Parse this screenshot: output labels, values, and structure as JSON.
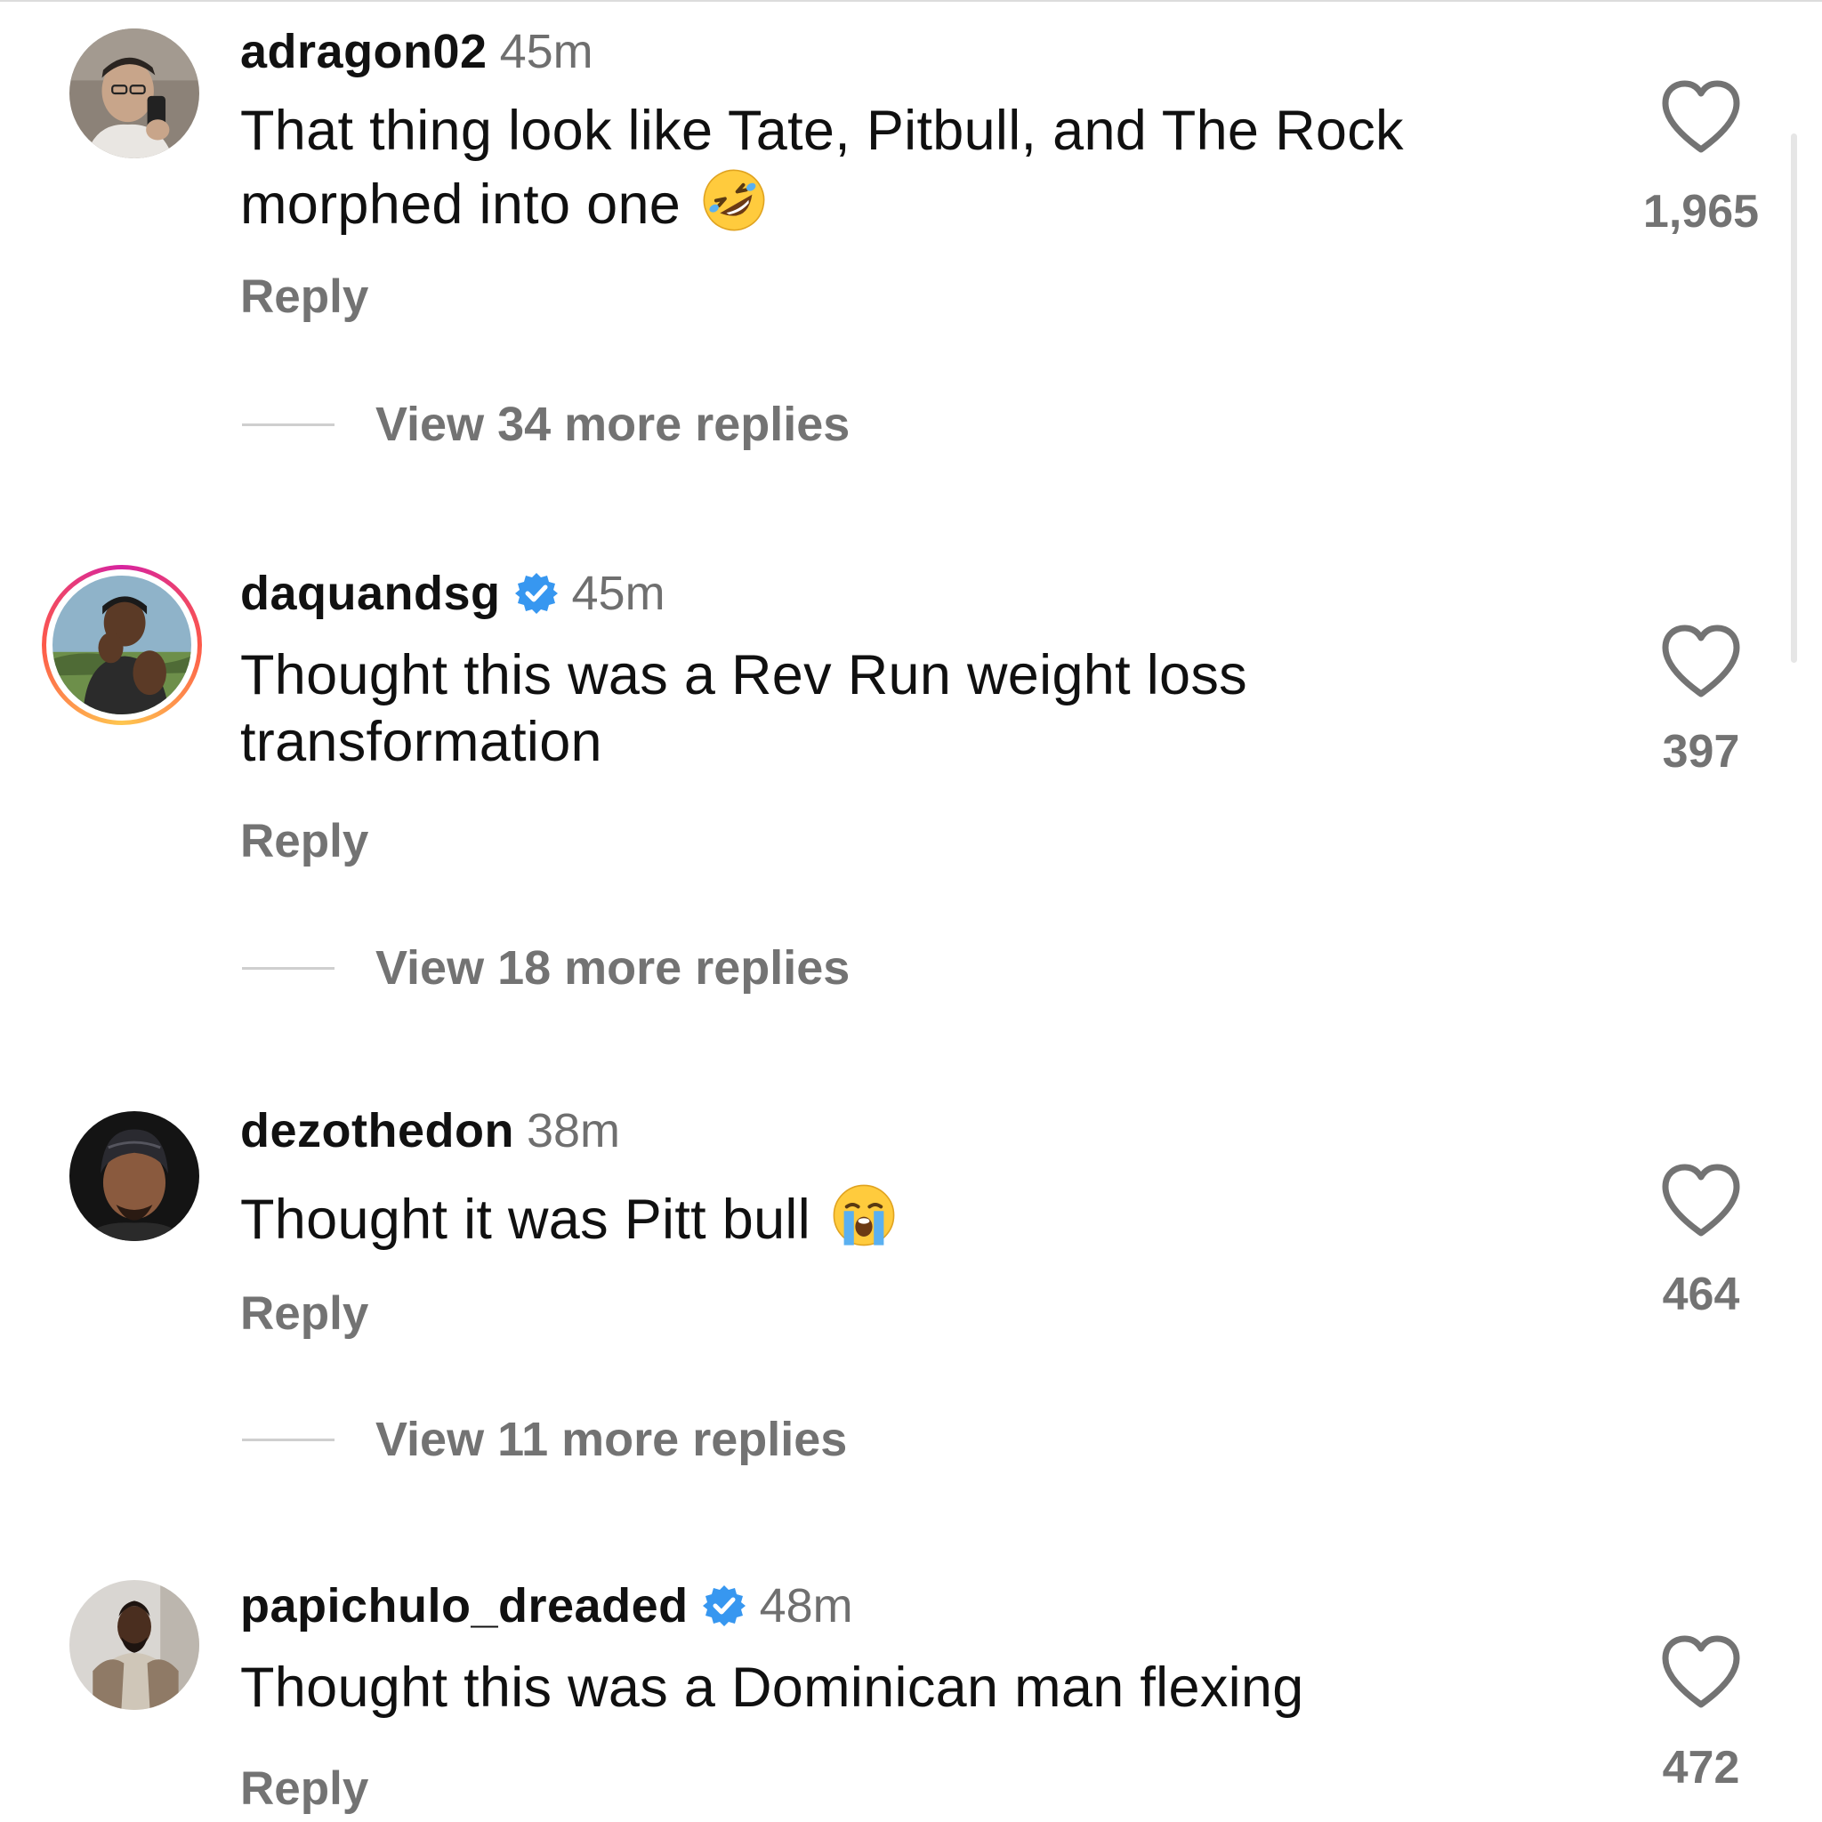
{
  "comments": [
    {
      "username": "adragon02",
      "verified": false,
      "time": "45m",
      "text": "That thing look like Tate, Pitbull, and The Rock morphed into one",
      "emoji": "rolling-on-floor-laughing-emoji",
      "reply_label": "Reply",
      "likes": "1,965",
      "view_replies": "View 34 more replies"
    },
    {
      "username": "daquandsg",
      "verified": true,
      "has_story_ring": true,
      "time": "45m",
      "text": "Thought this was a Rev Run weight loss transformation",
      "reply_label": "Reply",
      "likes": "397",
      "view_replies": "View 18 more replies"
    },
    {
      "username": "dezothedon",
      "verified": false,
      "time": "38m",
      "text": "Thought it was Pitt bull",
      "emoji": "loudly-crying-face-emoji",
      "reply_label": "Reply",
      "likes": "464",
      "view_replies": "View 11 more replies"
    },
    {
      "username": "papichulo_dreaded",
      "verified": true,
      "time": "48m",
      "text": "Thought this was a Dominican man flexing",
      "reply_label": "Reply",
      "likes": "472"
    }
  ],
  "icons": {
    "like": "heart-outline-icon",
    "verified": "verified-badge-icon"
  },
  "colors": {
    "verified_blue": "#3797f0",
    "secondary_text": "#737373",
    "story_ring_gradient": [
      "#d6249f",
      "#fd5949",
      "#fec64f"
    ]
  }
}
